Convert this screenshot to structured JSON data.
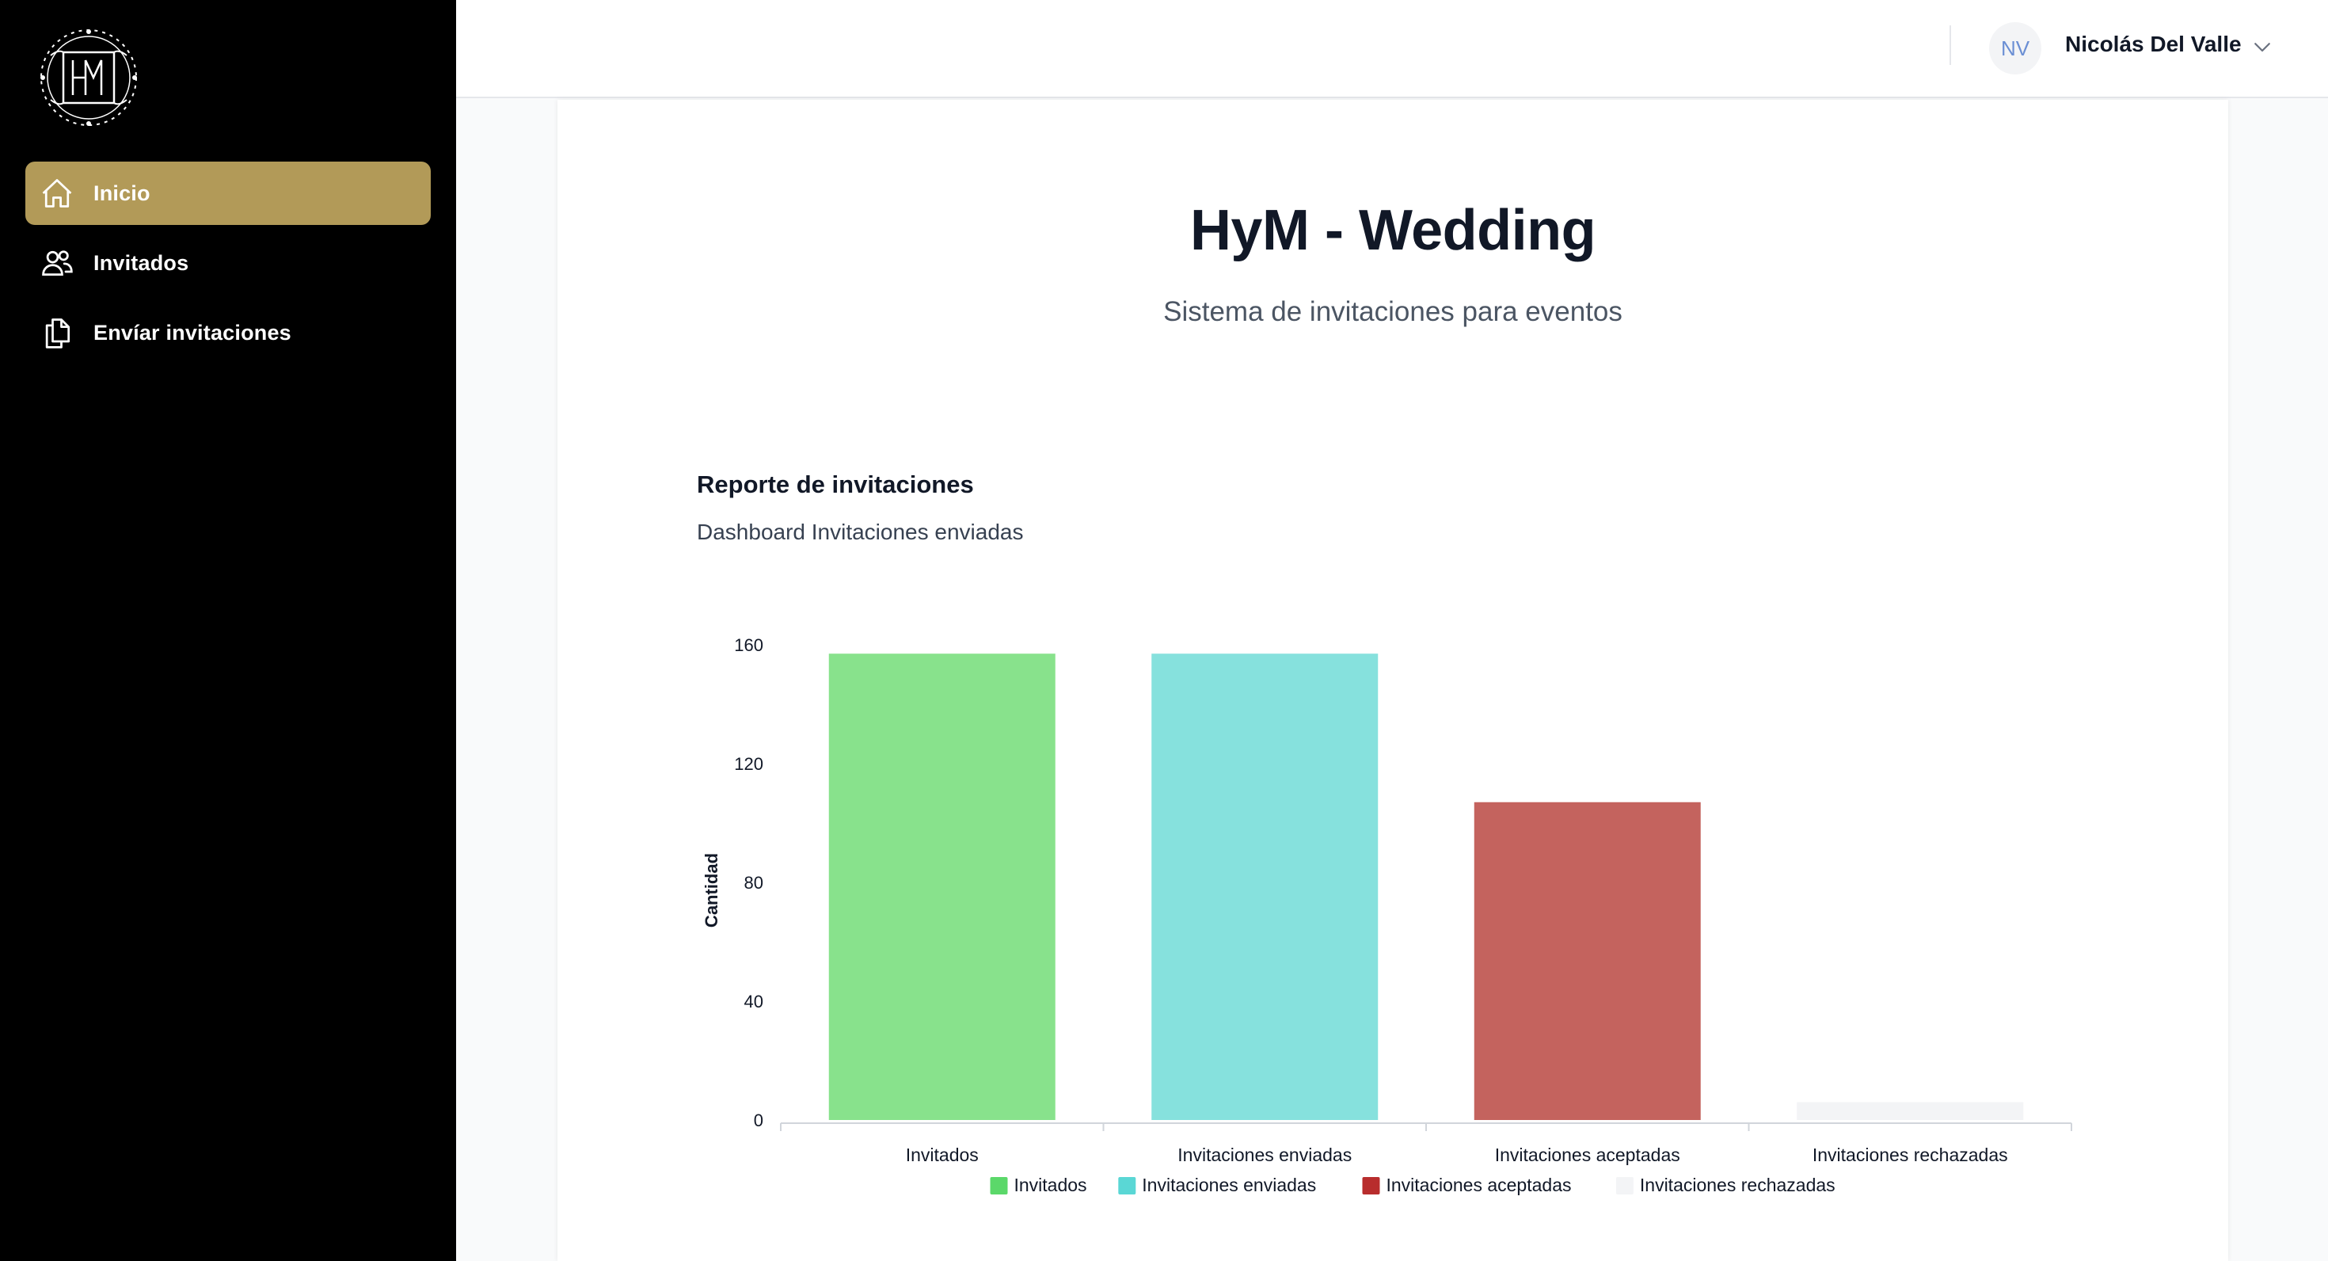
{
  "sidebar": {
    "items": [
      {
        "label": "Inicio",
        "icon": "home-icon",
        "active": true
      },
      {
        "label": "Invitados",
        "icon": "users-icon",
        "active": false
      },
      {
        "label": "Envíar invitaciones",
        "icon": "documents-icon",
        "active": false
      }
    ]
  },
  "header": {
    "avatar_initials": "NV",
    "user_name": "Nicolás Del Valle"
  },
  "main": {
    "title": "HyM - Wedding",
    "subtitle": "Sistema de invitaciones para eventos",
    "report_title": "Reporte de invitaciones",
    "report_subtitle": "Dashboard Invitaciones enviadas"
  },
  "colors": {
    "accent": "#b29a58",
    "sidebar_bg": "#000000"
  },
  "chart_data": {
    "type": "bar",
    "categories": [
      "Invitados",
      "Invitaciones enviadas",
      "Invitaciones aceptadas",
      "Invitaciones rechazadas"
    ],
    "values": [
      157,
      157,
      107,
      6
    ],
    "colors": [
      "#88e28c",
      "#86e1dd",
      "#c4635e",
      "#f3f4f6"
    ],
    "legend": [
      {
        "label": "Invitados",
        "color": "#5bd86a"
      },
      {
        "label": "Invitaciones enviadas",
        "color": "#5ad7d5"
      },
      {
        "label": "Invitaciones aceptadas",
        "color": "#b82d2d"
      },
      {
        "label": "Invitaciones rechazadas",
        "color": "#f3f4f6"
      }
    ],
    "ylabel": "Cantidad",
    "yticks": [
      0,
      40,
      80,
      120,
      160
    ],
    "ylim": [
      0,
      160
    ],
    "legend_position": "bottom",
    "grid": false
  }
}
